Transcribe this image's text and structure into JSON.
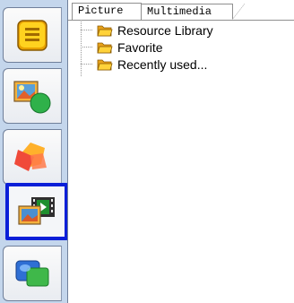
{
  "tabs": [
    {
      "label": "Picture",
      "active": true
    },
    {
      "label": "Multimedia",
      "active": false
    }
  ],
  "tree": [
    {
      "label": "Resource Library"
    },
    {
      "label": "Favorite"
    },
    {
      "label": "Recently used..."
    }
  ],
  "side_tabs": [
    {
      "icon": "notes-icon"
    },
    {
      "icon": "image-shapes-icon"
    },
    {
      "icon": "shapes-icon"
    },
    {
      "icon": "video-media-icon",
      "selected": true
    },
    {
      "icon": "clipart-icon"
    }
  ],
  "colors": {
    "selection_border": "#0a1fd8",
    "strip": "#c4d6ec"
  }
}
